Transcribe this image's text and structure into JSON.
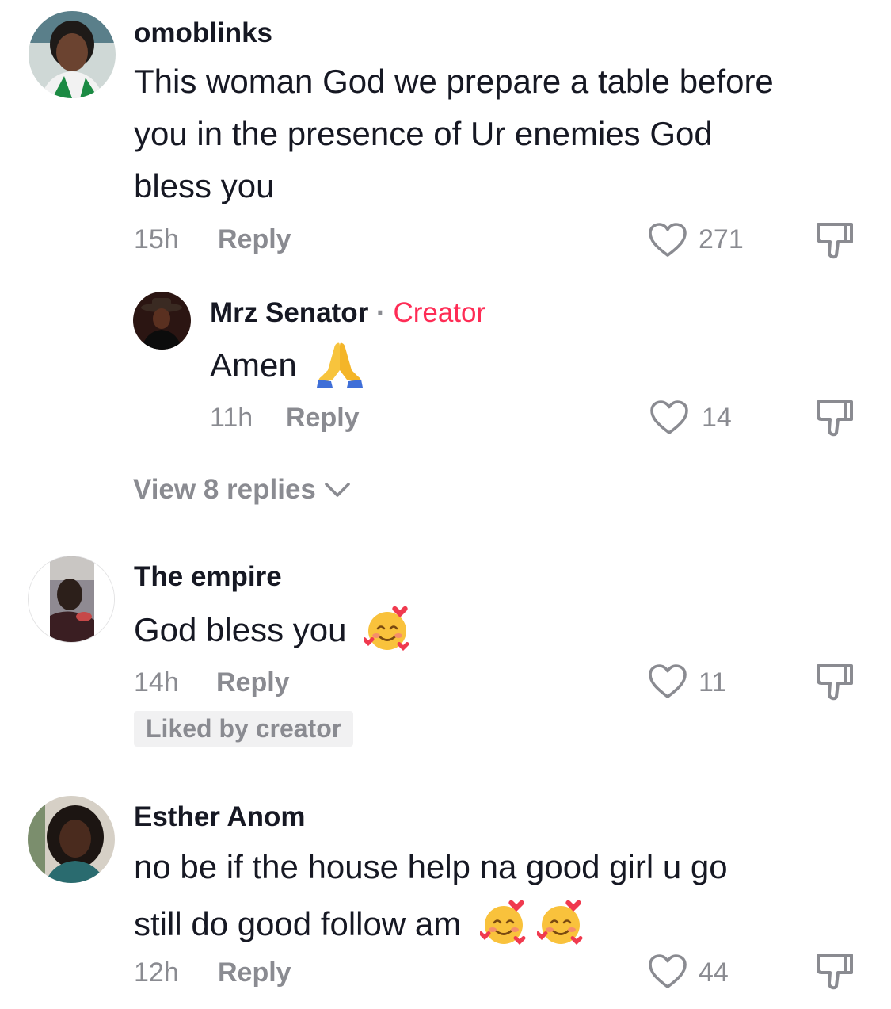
{
  "comments": [
    {
      "username": "omoblinks",
      "text_lines": [
        "This woman God we prepare a table before",
        "you in the presence of Ur enemies God",
        "bless you"
      ],
      "time": "15h",
      "reply_label": "Reply",
      "likes": "271",
      "avatar_icon": "avatar-woman-green-outfit"
    },
    {
      "username": "Mrz Senator",
      "separator": "·",
      "badge": "Creator",
      "text": "Amen",
      "emoji": "folded-hands-icon",
      "time": "11h",
      "reply_label": "Reply",
      "likes": "14",
      "avatar_icon": "avatar-woman-hat-dark"
    },
    {
      "username": "The empire",
      "text": "God bless you",
      "emoji": "smiling-face-with-hearts-icon",
      "time": "14h",
      "reply_label": "Reply",
      "likes": "11",
      "liked_by_creator": "Liked by creator",
      "avatar_icon": "avatar-person-photo"
    },
    {
      "username": "Esther Anom",
      "text_lines": [
        "no be if the house help na good girl u go",
        "still do good follow am"
      ],
      "emoji": "smiling-face-with-hearts-icon",
      "time": "12h",
      "reply_label": "Reply",
      "likes": "44",
      "avatar_icon": "avatar-woman-curly-hair"
    }
  ],
  "view_replies": "View 8 replies",
  "colors": {
    "text_primary": "#161823",
    "text_secondary": "#8a8b91",
    "creator_accent": "#fe2c55",
    "badge_bg": "#f1f1f2"
  }
}
